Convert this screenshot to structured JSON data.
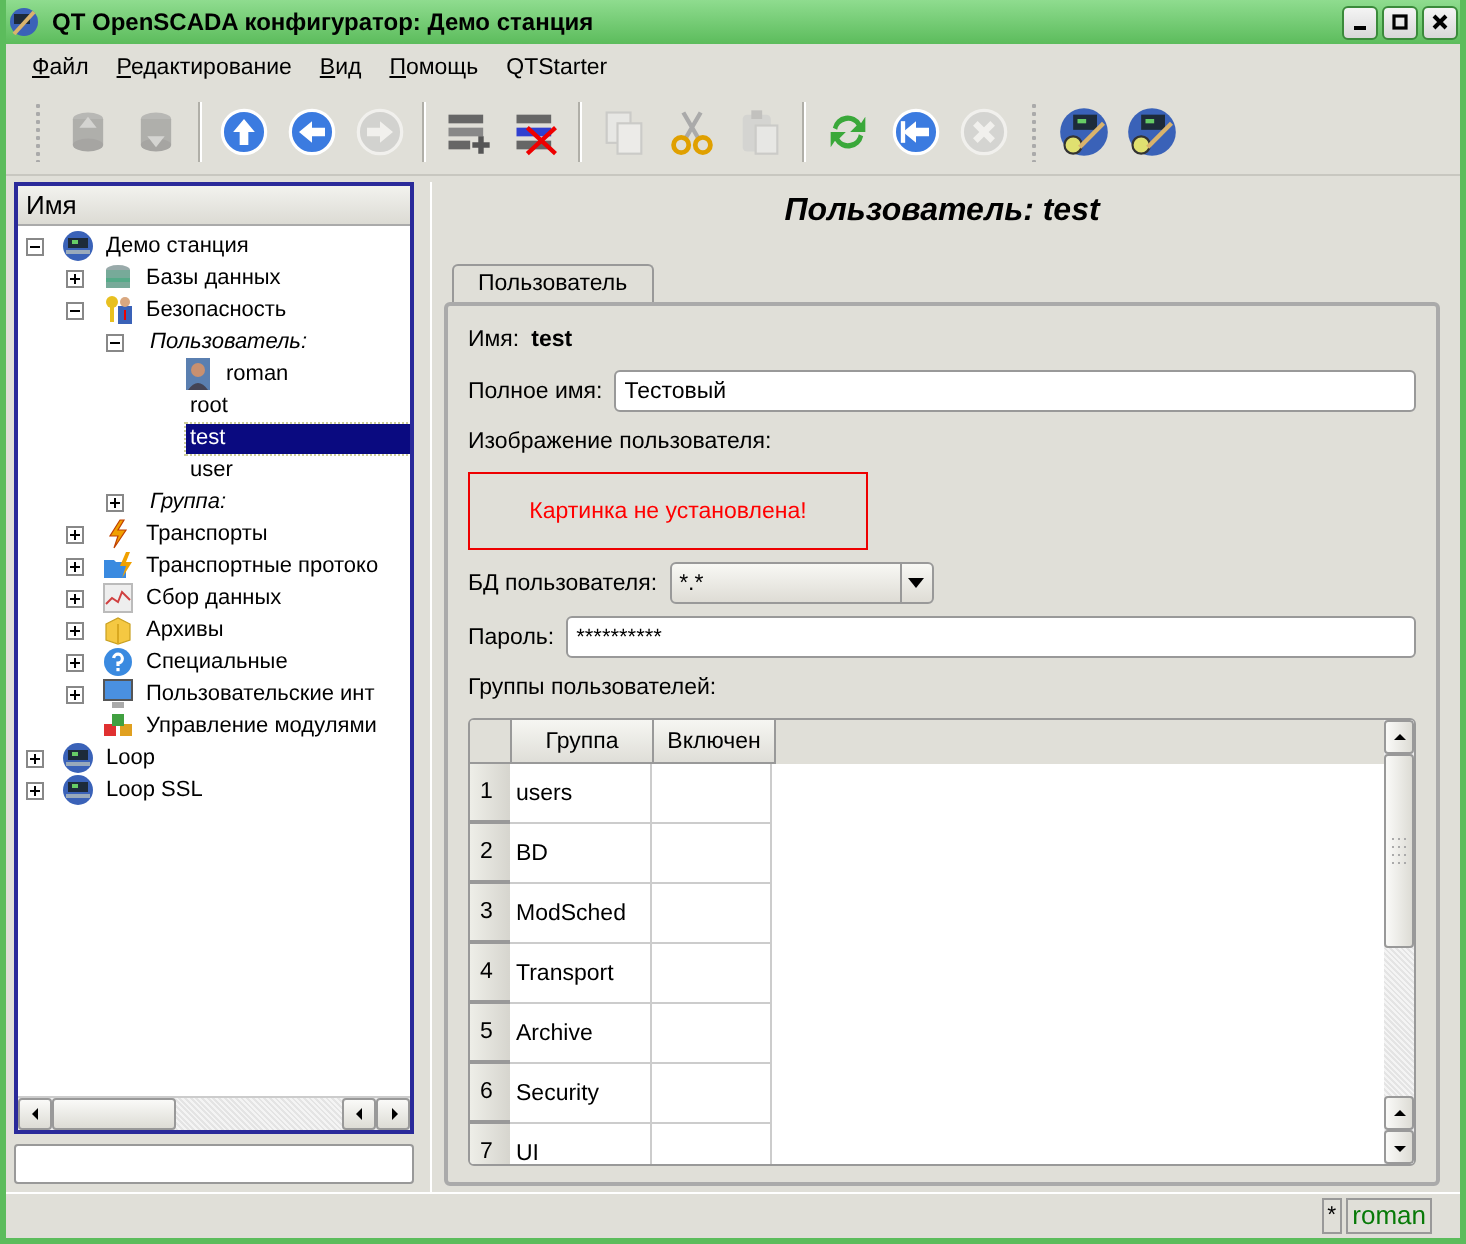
{
  "window": {
    "title": "QT OpenSCADA конфигуратор: Демо станция"
  },
  "menu": [
    {
      "label": "Файл",
      "mnemonic": true
    },
    {
      "label": "Редактирование",
      "mnemonic": true
    },
    {
      "label": "Вид",
      "mnemonic": true
    },
    {
      "label": "Помощь",
      "mnemonic": true
    },
    {
      "label": "QTStarter",
      "mnemonic": false
    }
  ],
  "toolbar": [
    [
      {
        "kind": "db-up",
        "disabled": true
      },
      {
        "kind": "db-down",
        "disabled": true
      }
    ],
    [
      {
        "kind": "up",
        "disabled": false
      },
      {
        "kind": "back",
        "disabled": false
      },
      {
        "kind": "forward",
        "disabled": true
      }
    ],
    [
      {
        "kind": "add",
        "disabled": false
      },
      {
        "kind": "delete",
        "disabled": false
      }
    ],
    [
      {
        "kind": "copy",
        "disabled": true
      },
      {
        "kind": "cut",
        "disabled": false
      },
      {
        "kind": "paste",
        "disabled": true
      }
    ],
    [
      {
        "kind": "refresh",
        "disabled": false
      },
      {
        "kind": "home",
        "disabled": false
      },
      {
        "kind": "stop",
        "disabled": true
      }
    ],
    [
      {
        "kind": "tool",
        "disabled": false
      },
      {
        "kind": "tool",
        "disabled": false
      }
    ]
  ],
  "tree": {
    "header": "Имя",
    "items": [
      {
        "label": "Демо станция",
        "kind": "station",
        "expanded": true,
        "selected": false,
        "children": [
          {
            "label": "Базы данных",
            "kind": "db",
            "expanded": false,
            "selected": false
          },
          {
            "label": "Безопасность",
            "kind": "security",
            "expanded": true,
            "selected": false,
            "children": [
              {
                "label": "Пользователь:",
                "kind": "category",
                "expanded": true,
                "selected": false,
                "children": [
                  {
                    "label": "roman",
                    "kind": "user-photo",
                    "selected": false
                  },
                  {
                    "label": "root",
                    "kind": "user",
                    "selected": false
                  },
                  {
                    "label": "test",
                    "kind": "user",
                    "selected": true
                  },
                  {
                    "label": "user",
                    "kind": "user",
                    "selected": false
                  }
                ]
              },
              {
                "label": "Группа:",
                "kind": "category",
                "expanded": false,
                "selected": false
              }
            ]
          },
          {
            "label": "Транспорты",
            "kind": "transport",
            "expanded": false,
            "selected": false
          },
          {
            "label": "Транспортные протоко",
            "kind": "protocol",
            "expanded": false,
            "selected": false
          },
          {
            "label": "Сбор данных",
            "kind": "daq",
            "expanded": false,
            "selected": false
          },
          {
            "label": "Архивы",
            "kind": "archive",
            "expanded": false,
            "selected": false
          },
          {
            "label": "Специальные",
            "kind": "special",
            "expanded": false,
            "selected": false
          },
          {
            "label": "Пользовательские инт",
            "kind": "ui",
            "expanded": false,
            "selected": false
          },
          {
            "label": "Управление модулями",
            "kind": "modules",
            "selected": false
          }
        ]
      },
      {
        "label": "Loop",
        "kind": "station",
        "expanded": false,
        "selected": false
      },
      {
        "label": "Loop SSL",
        "kind": "station",
        "expanded": false,
        "selected": false
      }
    ]
  },
  "panel": {
    "title": "Пользователь: test",
    "tabs": [
      {
        "label": "Пользователь",
        "selected": true
      }
    ],
    "name_label": "Имя:",
    "name_value": "test",
    "fullname_label": "Полное имя:",
    "fullname_value": "Тестовый",
    "image_label": "Изображение пользователя:",
    "image_message": "Картинка не установлена!",
    "db_label": "БД пользователя:",
    "db_value": "*.*",
    "password_label": "Пароль:",
    "password_value": "**********",
    "groups_label": "Группы пользователей:",
    "table": {
      "columns": [
        "Группа",
        "Включен"
      ],
      "rows": [
        {
          "num": "1",
          "group": "users"
        },
        {
          "num": "2",
          "group": "BD"
        },
        {
          "num": "3",
          "group": "ModSched"
        },
        {
          "num": "4",
          "group": "Transport"
        },
        {
          "num": "5",
          "group": "Archive"
        },
        {
          "num": "6",
          "group": "Security"
        },
        {
          "num": "7",
          "group": "UI"
        }
      ]
    }
  },
  "status_bar": {
    "modified": "*",
    "user": "roman"
  }
}
